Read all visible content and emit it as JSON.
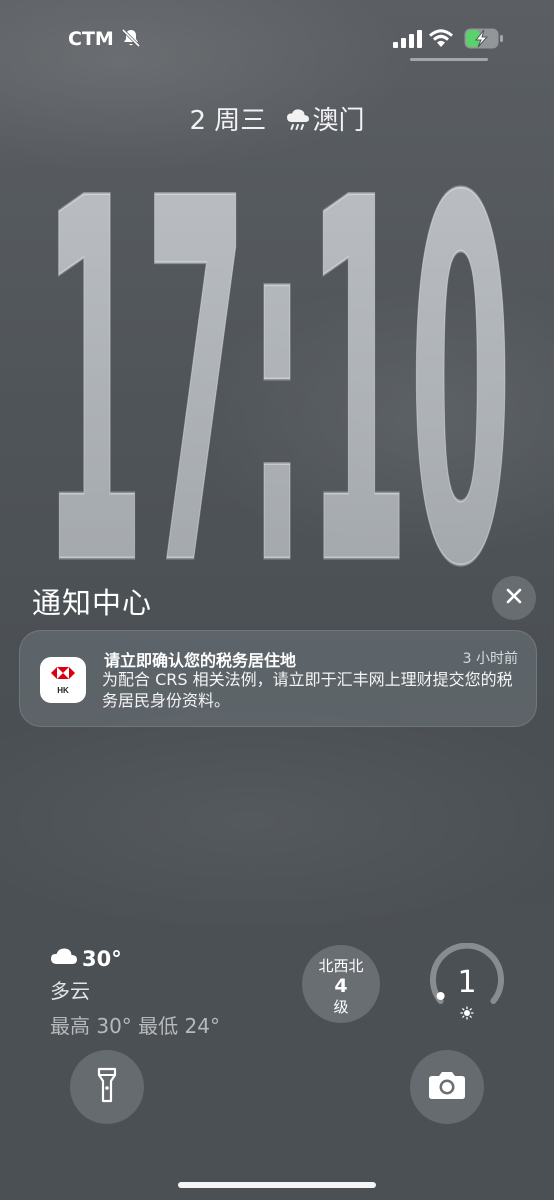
{
  "status_bar": {
    "carrier": "CTM",
    "icons": [
      "bell-slash-icon",
      "cellular-signal-icon",
      "wifi-icon",
      "battery-charging-icon"
    ],
    "battery_color": "#5ad16a"
  },
  "lock_screen": {
    "date": "2 周三",
    "weather_icon": "cloud-rain-icon",
    "city": "澳门",
    "time": "17:10"
  },
  "notification_center": {
    "title": "通知中心",
    "clear_icon": "close-icon",
    "notifications": [
      {
        "app_icon": "hsbc-hk-icon",
        "app_badge_text": "HK",
        "title": "请立即确认您的税务居住地",
        "time": "3 小时前",
        "body": "为配合 CRS 相关法例，请立即于汇丰网上理财提交您的税务居民身份资料。"
      }
    ]
  },
  "widgets": {
    "weather": {
      "icon": "cloud-icon",
      "temperature": "30°",
      "condition": "多云",
      "high_low": "最高 30° 最低 24°"
    },
    "wind": {
      "direction": "北西北",
      "level": "4",
      "unit": "级"
    },
    "uv": {
      "value": "1",
      "icon": "sun-icon"
    }
  },
  "quick_actions": {
    "flashlight_icon": "flashlight-icon",
    "camera_icon": "camera-icon"
  }
}
